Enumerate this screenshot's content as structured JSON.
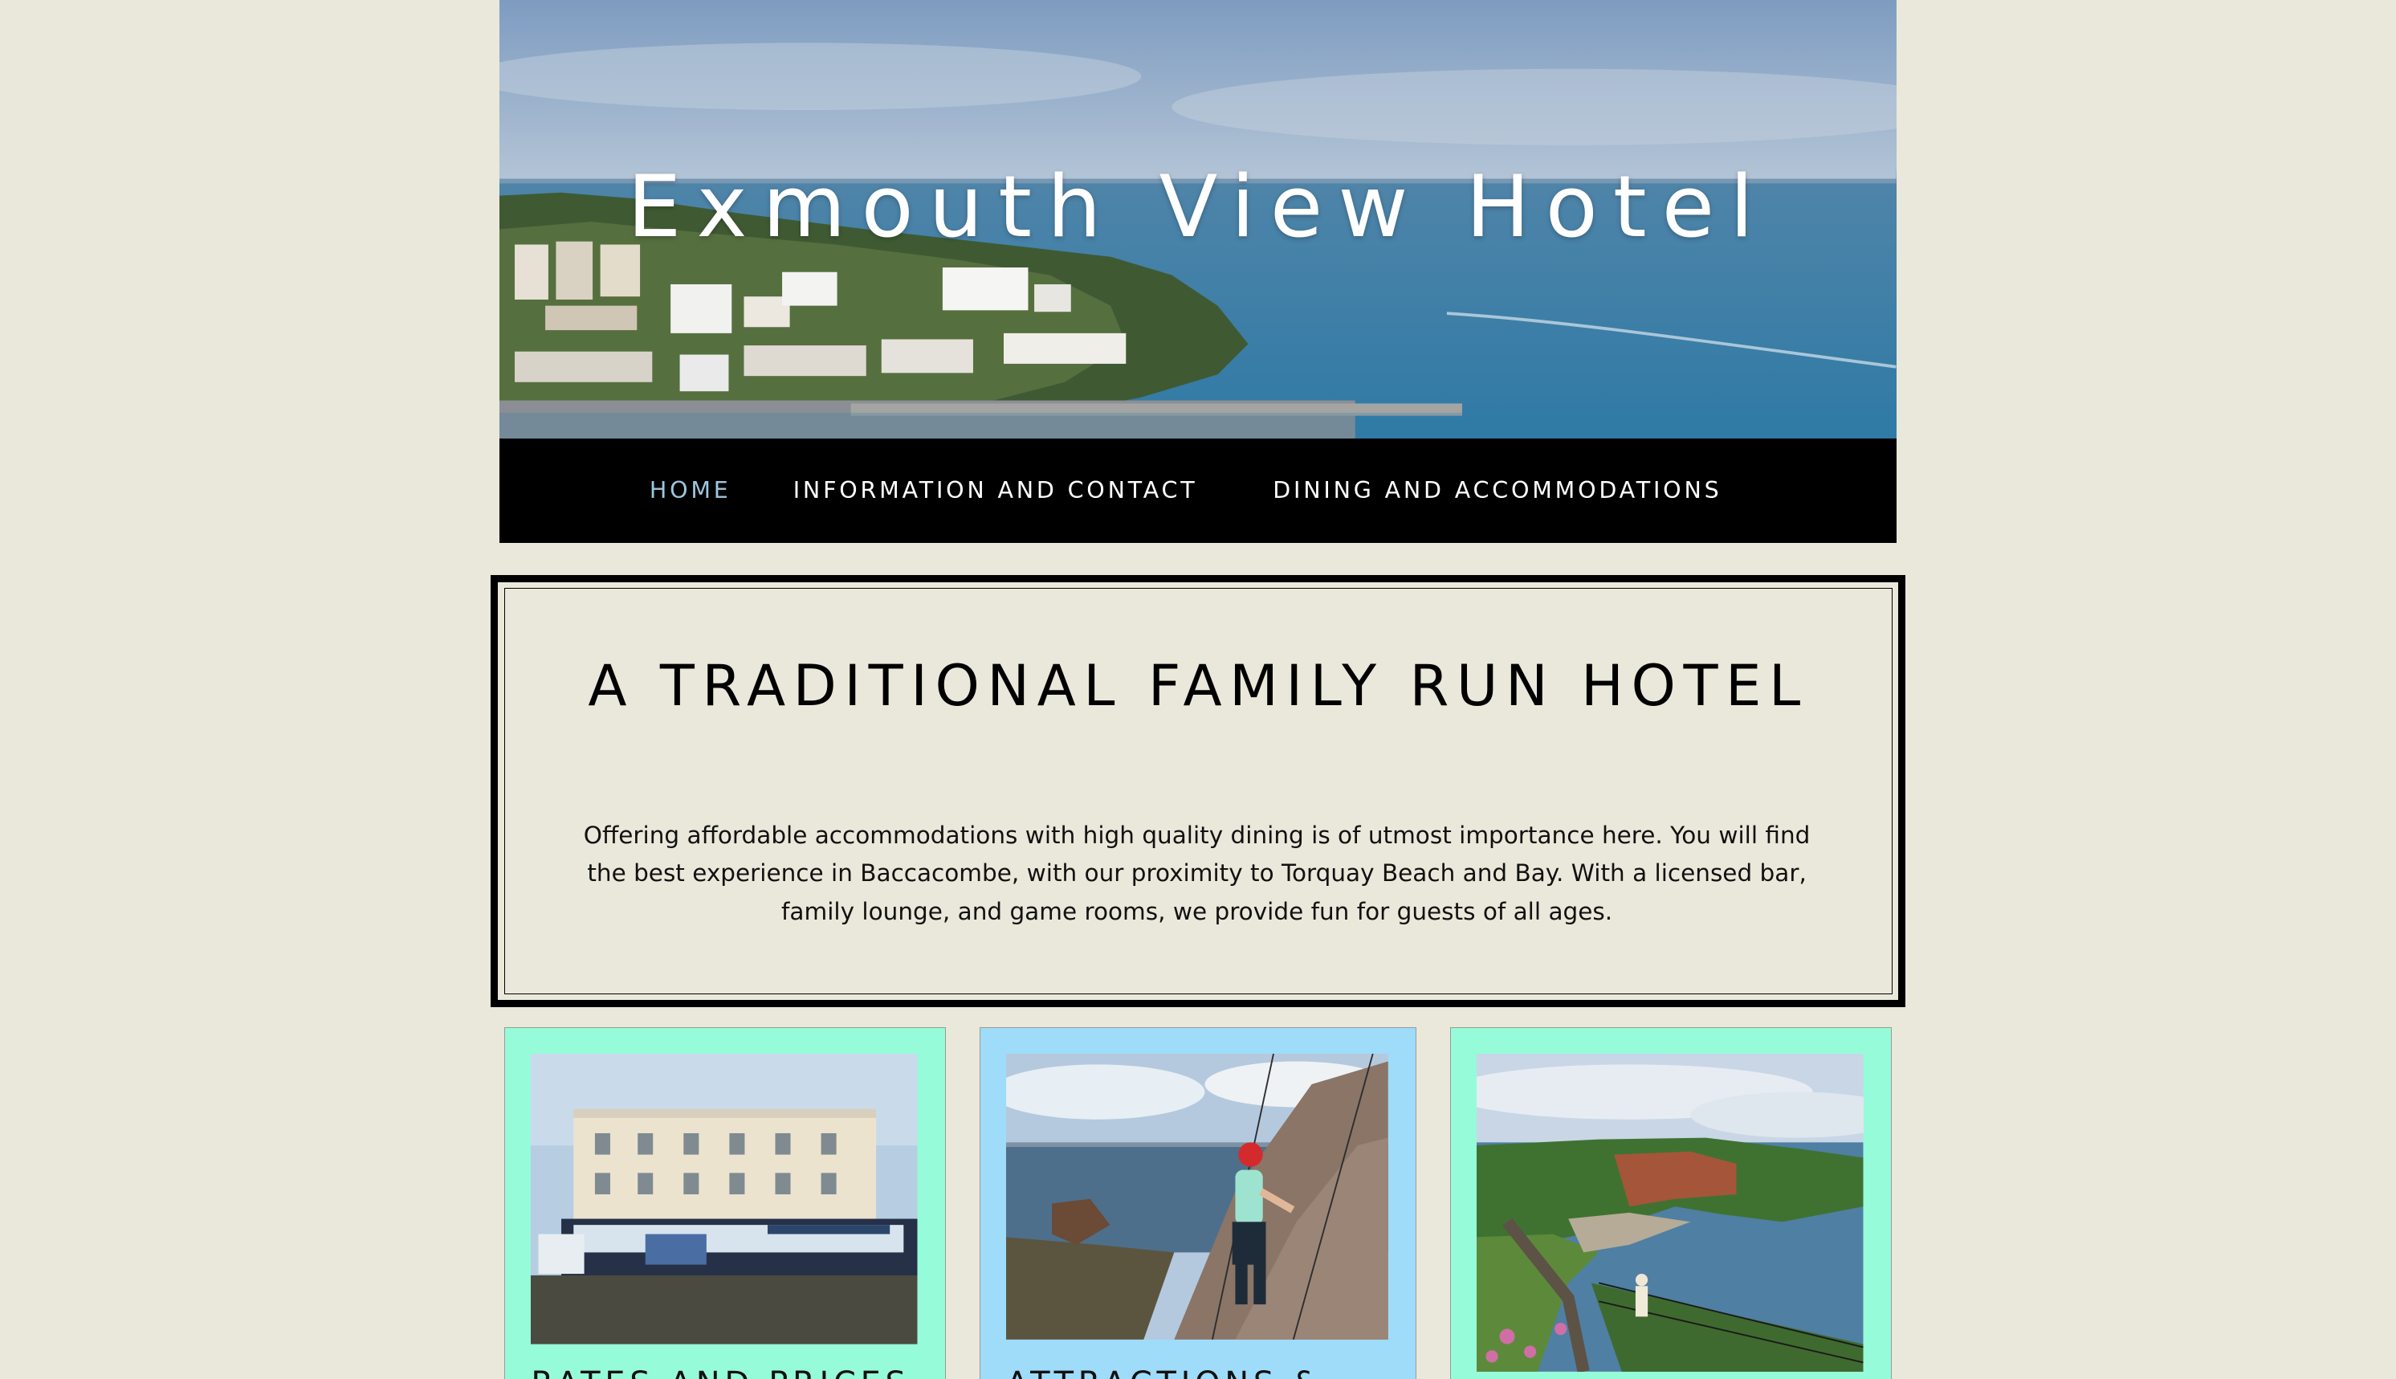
{
  "site": {
    "title": "Exmouth View Hotel"
  },
  "nav": {
    "items": [
      {
        "label": "HOME",
        "active": true
      },
      {
        "label": "INFORMATION AND CONTACT",
        "active": false
      },
      {
        "label": "DINING AND ACCOMMODATIONS",
        "active": false
      }
    ]
  },
  "intro": {
    "heading": "A TRADITIONAL FAMILY RUN HOTEL",
    "body": "Offering affordable accommodations with high quality dining is of utmost importance here. You will find the best experience in Baccacombe, with our proximity to Torquay Beach and Bay.  With a licensed bar, family lounge, and game rooms, we provide fun for guests of all ages."
  },
  "cards": [
    {
      "title": "RATES AND PRICES",
      "color": "#96fbd9"
    },
    {
      "title": "ATTRACTIONS &",
      "color": "#9edcf9"
    },
    {
      "title": "",
      "color": "#96fbd9"
    }
  ],
  "colors": {
    "page_background": "#eae8da",
    "nav_background": "#000000",
    "nav_active": "#9ec6de",
    "card_mint": "#96fbd9",
    "card_sky": "#9edcf9"
  }
}
